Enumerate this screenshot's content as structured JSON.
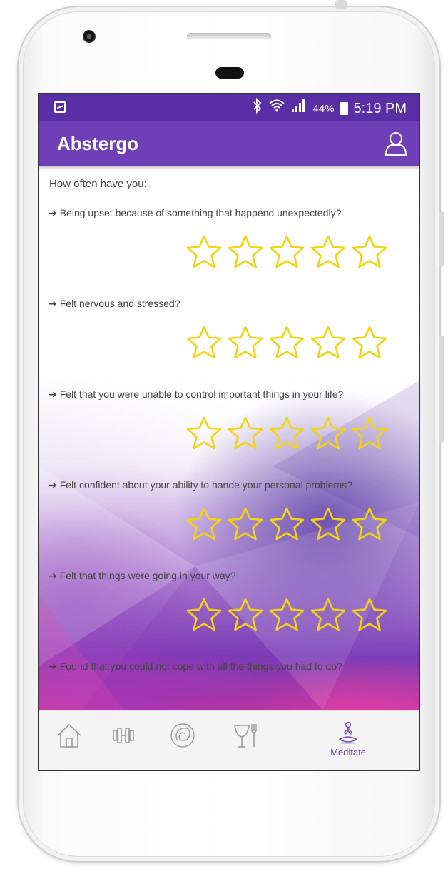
{
  "status_bar": {
    "bluetooth_icon": "bluetooth-icon",
    "wifi_icon": "wifi-icon",
    "signal_icon": "signal-icon",
    "battery_percent": "44%",
    "time": "5:19 PM"
  },
  "app_bar": {
    "title": "Abstergo",
    "profile_icon": "user-icon"
  },
  "survey": {
    "intro": "How often have you:",
    "arrow": "➔",
    "questions": [
      {
        "text": "Being upset because of something that happend unexpectedly?",
        "rating": 0,
        "max": 5
      },
      {
        "text": "Felt nervous and stressed?",
        "rating": 0,
        "max": 5
      },
      {
        "text": "Felt that you were unable to control important things in your life?",
        "rating": 0,
        "max": 5
      },
      {
        "text": "Felt confident about your ability to hande your personal problems?",
        "rating": 0,
        "max": 5
      },
      {
        "text": "Felt that things were going in your way?",
        "rating": 0,
        "max": 5
      },
      {
        "text": "Found that you could not cope with all the things you had to do?",
        "rating": 0,
        "max": 5
      }
    ]
  },
  "bottom_nav": {
    "items": [
      {
        "icon": "home-icon",
        "label": "",
        "active": false
      },
      {
        "icon": "dumbbell-icon",
        "label": "",
        "active": false
      },
      {
        "icon": "breath-icon",
        "label": "",
        "active": false
      },
      {
        "icon": "food-icon",
        "label": "",
        "active": false
      },
      {
        "icon": "meditate-icon",
        "label": "Meditate",
        "active": true
      }
    ]
  },
  "colors": {
    "status_bar": "#5a2fa5",
    "app_bar": "#6f3fb8",
    "star_outline": "#f6d40c",
    "nav_active": "#6f3fb8",
    "nav_inactive": "#9a9a9a"
  }
}
